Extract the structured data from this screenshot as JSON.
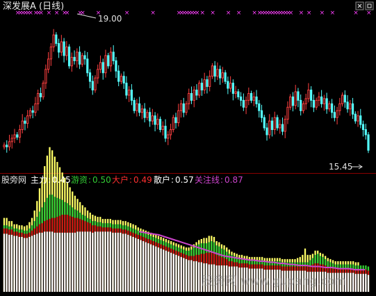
{
  "price_panel": {
    "title": "深发展A (日线)",
    "high_label": "19.00",
    "low_label": "15.45",
    "marker_glyph": "×"
  },
  "indicator_panel": {
    "label": "股旁网",
    "items": [
      {
        "key": "主力",
        "value": "0.45",
        "color": "#ffffff"
      },
      {
        "key": "游资",
        "value": "0.50",
        "color": "#33cc33"
      },
      {
        "key": "大户",
        "value": "0.49",
        "color": "#ff3030"
      },
      {
        "key": "散户",
        "value": "0.57",
        "color": "#ffffff"
      },
      {
        "key": "关注线",
        "value": "0.87",
        "color": "#cc44cc"
      }
    ]
  },
  "watermark": "股旁网 www.gupang.com",
  "colors": {
    "up": "#ff4040",
    "down": "#54ffff",
    "marker": "#ff40ff",
    "separator": "#8b0000",
    "retail_bar": "#ffffff",
    "dahu_bar": "#cc1111",
    "youzi_bar": "#33cc33",
    "zhuli_bar": "#ffff66",
    "guanzhu_line": "#cc44cc"
  },
  "chart_data": [
    {
      "type": "candlestick",
      "title": "深发展A (日线)",
      "ylim": [
        15.0,
        19.6
      ],
      "annotations": [
        {
          "text": "19.00",
          "value": 19.0
        },
        {
          "text": "15.45",
          "value": 15.45
        }
      ],
      "close": [
        15.75,
        15.7,
        15.85,
        15.95,
        16.05,
        15.98,
        16.2,
        16.45,
        16.38,
        16.6,
        16.75,
        16.7,
        16.95,
        17.25,
        17.15,
        17.55,
        17.95,
        18.25,
        18.6,
        18.95,
        18.7,
        18.45,
        18.75,
        18.35,
        18.6,
        18.05,
        18.3,
        18.2,
        18.45,
        18.1,
        18.35,
        18.25,
        17.85,
        17.6,
        17.35,
        17.7,
        17.95,
        18.15,
        17.85,
        18.35,
        18.05,
        18.45,
        18.2,
        17.9,
        17.6,
        17.75,
        17.55,
        17.2,
        17.35,
        17.05,
        16.75,
        16.95,
        16.7,
        16.8,
        16.55,
        16.7,
        16.45,
        16.6,
        16.35,
        16.5,
        16.2,
        16.3,
        15.95,
        16.05,
        16.2,
        16.55,
        16.4,
        16.75,
        16.95,
        16.7,
        16.95,
        17.25,
        17.05,
        17.35,
        17.2,
        17.55,
        17.35,
        17.65,
        17.45,
        17.75,
        18.05,
        17.75,
        17.95,
        17.7,
        17.85,
        17.6,
        17.4,
        17.55,
        17.25,
        17.3,
        17.15,
        17.05,
        16.85,
        17.05,
        17.25,
        17.05,
        17.15,
        16.95,
        16.75,
        16.55,
        16.25,
        16.05,
        16.45,
        16.2,
        16.55,
        16.25,
        16.35,
        16.15,
        16.5,
        16.85,
        17.15,
        16.9,
        17.3,
        17.05,
        16.75,
        16.95,
        17.1,
        17.35,
        17.05,
        16.85,
        17.05,
        17.15,
        16.95,
        17.1,
        16.8,
        16.95,
        16.7,
        16.55,
        16.75,
        16.95,
        17.2,
        17.0,
        16.8,
        16.95,
        16.65,
        16.45,
        16.6,
        16.35,
        16.2,
        16.05,
        15.6
      ]
    },
    {
      "type": "bar",
      "title": "股旁网",
      "ylim": [
        0,
        1
      ],
      "series": [
        {
          "name": "主力",
          "values": [
            0.07,
            0.07,
            0.05,
            0.05,
            0.04,
            0.04,
            0.04,
            0.04,
            0.04,
            0.05,
            0.06,
            0.07,
            0.1,
            0.15,
            0.22,
            0.28,
            0.34,
            0.4,
            0.45,
            0.42,
            0.38,
            0.34,
            0.3,
            0.26,
            0.23,
            0.2,
            0.17,
            0.15,
            0.13,
            0.11,
            0.1,
            0.09,
            0.08,
            0.07,
            0.06,
            0.06,
            0.05,
            0.05,
            0.05,
            0.04,
            0.04,
            0.04,
            0.04,
            0.04,
            0.04,
            0.04,
            0.04,
            0.04,
            0.04,
            0.04,
            0.04,
            0.04,
            0.04,
            0.03,
            0.03,
            0.03,
            0.03,
            0.03,
            0.03,
            0.03,
            0.03,
            0.03,
            0.03,
            0.03,
            0.03,
            0.03,
            0.03,
            0.03,
            0.03,
            0.03,
            0.03,
            0.03,
            0.03,
            0.03,
            0.03,
            0.03,
            0.03,
            0.04,
            0.04,
            0.05,
            0.05,
            0.06,
            0.05,
            0.05,
            0.04,
            0.04,
            0.04,
            0.04,
            0.04,
            0.04,
            0.03,
            0.03,
            0.03,
            0.03,
            0.03,
            0.03,
            0.03,
            0.03,
            0.03,
            0.03,
            0.03,
            0.03,
            0.03,
            0.03,
            0.03,
            0.03,
            0.03,
            0.03,
            0.03,
            0.03,
            0.03,
            0.03,
            0.03,
            0.03,
            0.03,
            0.03,
            0.04,
            0.05,
            0.07,
            0.13,
            0.07,
            0.05,
            0.04,
            0.04,
            0.03,
            0.03,
            0.03,
            0.03,
            0.03,
            0.03,
            0.03,
            0.03,
            0.03,
            0.03,
            0.03,
            0.03,
            0.03,
            0.03,
            0.03,
            0.03,
            0.03
          ]
        },
        {
          "name": "游资",
          "values": [
            0.03,
            0.03,
            0.03,
            0.03,
            0.03,
            0.03,
            0.03,
            0.03,
            0.03,
            0.03,
            0.04,
            0.05,
            0.07,
            0.09,
            0.12,
            0.15,
            0.18,
            0.21,
            0.23,
            0.22,
            0.2,
            0.18,
            0.16,
            0.14,
            0.12,
            0.11,
            0.1,
            0.09,
            0.08,
            0.07,
            0.06,
            0.05,
            0.05,
            0.04,
            0.04,
            0.04,
            0.04,
            0.04,
            0.04,
            0.04,
            0.04,
            0.04,
            0.04,
            0.04,
            0.04,
            0.04,
            0.04,
            0.04,
            0.04,
            0.04,
            0.04,
            0.04,
            0.04,
            0.04,
            0.04,
            0.04,
            0.04,
            0.04,
            0.04,
            0.04,
            0.04,
            0.04,
            0.04,
            0.04,
            0.04,
            0.04,
            0.04,
            0.04,
            0.04,
            0.04,
            0.04,
            0.04,
            0.04,
            0.05,
            0.06,
            0.08,
            0.09,
            0.1,
            0.1,
            0.1,
            0.09,
            0.1,
            0.11,
            0.1,
            0.09,
            0.09,
            0.08,
            0.08,
            0.07,
            0.07,
            0.06,
            0.06,
            0.05,
            0.05,
            0.05,
            0.04,
            0.04,
            0.04,
            0.04,
            0.04,
            0.04,
            0.04,
            0.04,
            0.04,
            0.04,
            0.04,
            0.04,
            0.04,
            0.04,
            0.04,
            0.04,
            0.04,
            0.04,
            0.04,
            0.04,
            0.04,
            0.04,
            0.04,
            0.04,
            0.04,
            0.04,
            0.05,
            0.06,
            0.08,
            0.09,
            0.08,
            0.07,
            0.06,
            0.06,
            0.05,
            0.05,
            0.04,
            0.04,
            0.04,
            0.04,
            0.04,
            0.04,
            0.04,
            0.04,
            0.04,
            0.04,
            0.04,
            0.04,
            0.04,
            0.04
          ]
        },
        {
          "name": "大户",
          "values": [
            0.05,
            0.05,
            0.05,
            0.05,
            0.04,
            0.04,
            0.04,
            0.04,
            0.04,
            0.04,
            0.04,
            0.05,
            0.06,
            0.07,
            0.08,
            0.09,
            0.1,
            0.11,
            0.12,
            0.13,
            0.14,
            0.15,
            0.16,
            0.17,
            0.17,
            0.17,
            0.16,
            0.15,
            0.14,
            0.13,
            0.12,
            0.11,
            0.1,
            0.09,
            0.08,
            0.07,
            0.06,
            0.05,
            0.05,
            0.04,
            0.04,
            0.04,
            0.04,
            0.04,
            0.04,
            0.04,
            0.04,
            0.04,
            0.04,
            0.04,
            0.04,
            0.04,
            0.04,
            0.04,
            0.04,
            0.04,
            0.04,
            0.04,
            0.04,
            0.04,
            0.04,
            0.04,
            0.04,
            0.04,
            0.04,
            0.04,
            0.04,
            0.04,
            0.04,
            0.04,
            0.04,
            0.04,
            0.04,
            0.04,
            0.04,
            0.05,
            0.06,
            0.07,
            0.08,
            0.09,
            0.1,
            0.11,
            0.11,
            0.11,
            0.1,
            0.09,
            0.08,
            0.07,
            0.06,
            0.05,
            0.05,
            0.04,
            0.04,
            0.04,
            0.04,
            0.04,
            0.04,
            0.04,
            0.04,
            0.04,
            0.04,
            0.04,
            0.04,
            0.04,
            0.04,
            0.04,
            0.04,
            0.04,
            0.04,
            0.04,
            0.04,
            0.04,
            0.04,
            0.04,
            0.04,
            0.04,
            0.04,
            0.04,
            0.04,
            0.04,
            0.05,
            0.06,
            0.07,
            0.08,
            0.08,
            0.07,
            0.07,
            0.06,
            0.05,
            0.05,
            0.04,
            0.04,
            0.04,
            0.04,
            0.04,
            0.04,
            0.04,
            0.04,
            0.04,
            0.04,
            0.04,
            0.04,
            0.04,
            0.04,
            0.04
          ]
        },
        {
          "name": "散户",
          "values": [
            0.55,
            0.55,
            0.54,
            0.54,
            0.53,
            0.53,
            0.52,
            0.52,
            0.51,
            0.51,
            0.52,
            0.53,
            0.54,
            0.55,
            0.56,
            0.56,
            0.57,
            0.57,
            0.57,
            0.57,
            0.56,
            0.56,
            0.56,
            0.56,
            0.56,
            0.56,
            0.56,
            0.56,
            0.56,
            0.57,
            0.57,
            0.57,
            0.57,
            0.57,
            0.57,
            0.56,
            0.57,
            0.57,
            0.57,
            0.57,
            0.57,
            0.57,
            0.57,
            0.56,
            0.56,
            0.56,
            0.56,
            0.55,
            0.55,
            0.54,
            0.53,
            0.52,
            0.51,
            0.5,
            0.49,
            0.48,
            0.47,
            0.46,
            0.45,
            0.44,
            0.43,
            0.42,
            0.41,
            0.4,
            0.39,
            0.38,
            0.37,
            0.36,
            0.35,
            0.34,
            0.33,
            0.32,
            0.31,
            0.3,
            0.3,
            0.29,
            0.29,
            0.28,
            0.28,
            0.27,
            0.27,
            0.26,
            0.26,
            0.26,
            0.25,
            0.25,
            0.25,
            0.25,
            0.25,
            0.24,
            0.24,
            0.24,
            0.24,
            0.23,
            0.23,
            0.23,
            0.23,
            0.22,
            0.22,
            0.22,
            0.22,
            0.22,
            0.22,
            0.21,
            0.21,
            0.21,
            0.21,
            0.21,
            0.21,
            0.21,
            0.2,
            0.2,
            0.2,
            0.2,
            0.2,
            0.2,
            0.2,
            0.2,
            0.2,
            0.2,
            0.19,
            0.19,
            0.19,
            0.19,
            0.19,
            0.19,
            0.19,
            0.19,
            0.18,
            0.18,
            0.18,
            0.18,
            0.18,
            0.18,
            0.18,
            0.18,
            0.18,
            0.18,
            0.18,
            0.17,
            0.17,
            0.17,
            0.17,
            0.17,
            0.16
          ]
        },
        {
          "name": "关注线",
          "values": [
            0.57,
            0.565,
            0.56,
            0.555,
            0.55,
            0.545,
            0.54,
            0.53,
            0.52,
            0.51,
            0.5,
            0.49,
            0.48,
            0.47,
            0.46,
            0.45,
            0.44,
            0.43,
            0.42,
            0.41,
            0.4,
            0.39,
            0.38,
            0.37,
            0.36,
            0.35,
            0.34,
            0.335,
            0.33,
            0.325,
            0.32,
            0.315,
            0.31,
            0.305,
            0.3,
            0.3,
            0.295,
            0.29,
            0.29,
            0.285,
            0.28,
            0.28,
            0.275,
            0.27,
            0.27,
            0.265,
            0.26,
            0.26,
            0.255,
            0.25,
            0.25,
            0.25,
            0.245,
            0.24,
            0.24,
            0.24,
            0.235,
            0.23,
            0.23,
            0.23,
            0.225,
            0.22,
            0.22,
            0.22,
            0.22,
            0.215,
            0.21,
            0.21,
            0.21,
            0.21
          ]
        }
      ]
    }
  ]
}
